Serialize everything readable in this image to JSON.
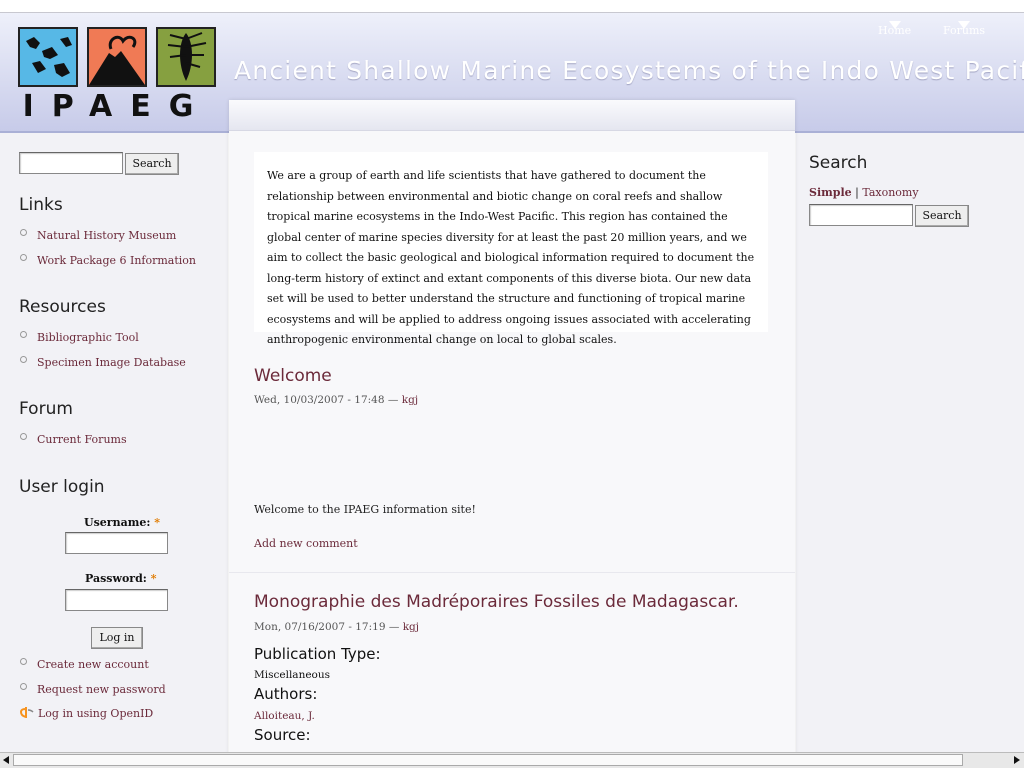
{
  "site": {
    "logo_text": "IPAEG",
    "title": "Ancient Shallow Marine Ecosystems of the Indo West Pacific"
  },
  "nav": {
    "home": "Home",
    "forums": "Forums"
  },
  "left": {
    "search_button": "Search",
    "links_title": "Links",
    "links": [
      "Natural History Museum",
      "Work Package 6 Information"
    ],
    "resources_title": "Resources",
    "resources": [
      "Bibliographic Tool",
      "Specimen Image Database"
    ],
    "forum_title": "Forum",
    "forum_items": [
      "Current Forums"
    ],
    "login": {
      "title": "User login",
      "username_label": "Username:",
      "password_label": "Password:",
      "required_mark": "*",
      "login_button": "Log in",
      "links": [
        "Create new account",
        "Request new password",
        "Log in using OpenID"
      ]
    }
  },
  "right": {
    "search_title": "Search",
    "tab_simple": "Simple",
    "tab_sep": "|",
    "tab_taxonomy": "Taxonomy",
    "search_button": "Search"
  },
  "main": {
    "intro": "We are a group of earth and life scientists that have gathered to document the relationship between environmental and biotic change on coral reefs and shallow tropical marine ecosystems in the Indo-West Pacific. This region has contained the global center of marine species diversity for at least the past 20 million years, and we aim to collect the basic geological and biological information required to document the long-term history of extinct and extant components of this diverse biota. Our new data set will be used to better understand the structure and functioning of tropical marine ecosystems and will be applied to address ongoing issues associated with accelerating anthropogenic environmental change on local to global scales.",
    "node1": {
      "title": "Welcome",
      "date": "Wed, 10/03/2007 - 17:48 — ",
      "author": "kgj",
      "body": "Welcome to the IPAEG information site!",
      "comment_link": "Add new comment"
    },
    "node2": {
      "title": "Monographie des Madréporaires Fossiles de Madagascar.",
      "date": "Mon, 07/16/2007 - 17:19 — ",
      "author": "kgj",
      "pub_type_label": "Publication Type:",
      "pub_type": "Miscellaneous",
      "authors_label": "Authors:",
      "authors": "Alloiteau, J.",
      "source_label": "Source:"
    }
  },
  "colors": {
    "link": "#6b2a3a",
    "header_top": "#eef0fa",
    "header_bottom": "#c7cbe9",
    "sidebar": "#f2f2f6"
  }
}
